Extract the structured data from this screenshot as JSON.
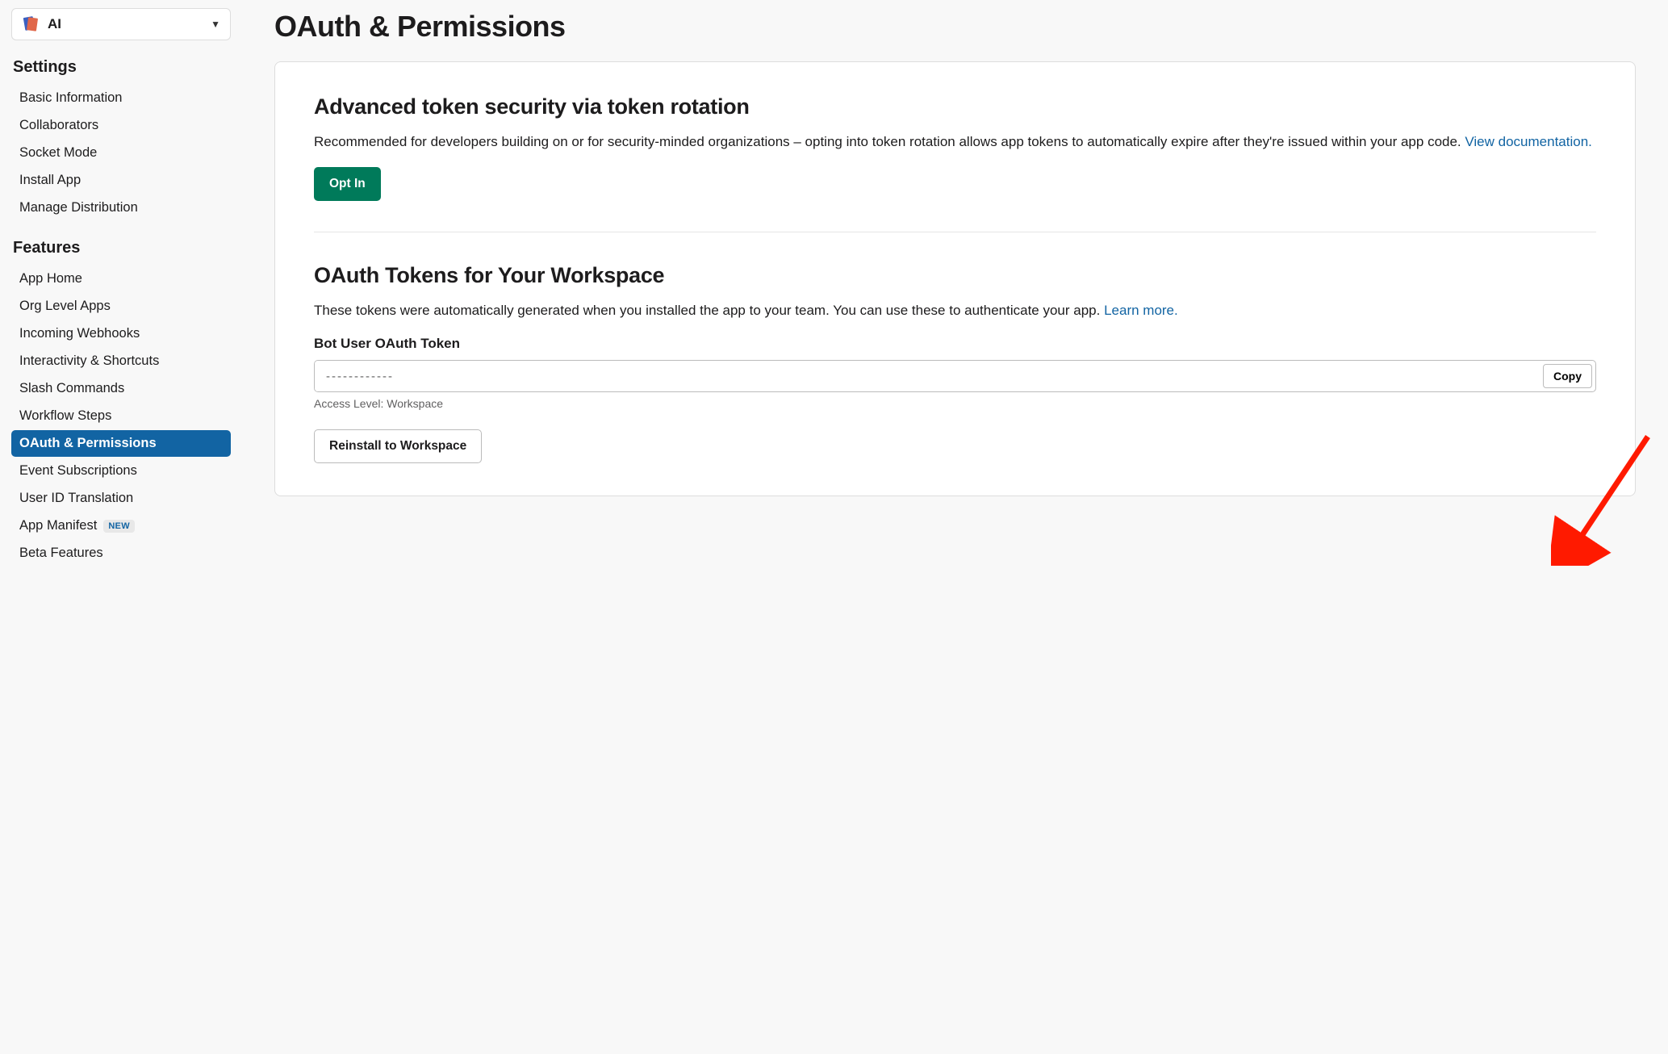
{
  "app_selector": {
    "name": "AI"
  },
  "sidebar": {
    "settings_heading": "Settings",
    "settings_items": [
      {
        "label": "Basic Information",
        "active": false
      },
      {
        "label": "Collaborators",
        "active": false
      },
      {
        "label": "Socket Mode",
        "active": false
      },
      {
        "label": "Install App",
        "active": false
      },
      {
        "label": "Manage Distribution",
        "active": false
      }
    ],
    "features_heading": "Features",
    "features_items": [
      {
        "label": "App Home",
        "active": false,
        "badge": null
      },
      {
        "label": "Org Level Apps",
        "active": false,
        "badge": null
      },
      {
        "label": "Incoming Webhooks",
        "active": false,
        "badge": null
      },
      {
        "label": "Interactivity & Shortcuts",
        "active": false,
        "badge": null
      },
      {
        "label": "Slash Commands",
        "active": false,
        "badge": null
      },
      {
        "label": "Workflow Steps",
        "active": false,
        "badge": null
      },
      {
        "label": "OAuth & Permissions",
        "active": true,
        "badge": null
      },
      {
        "label": "Event Subscriptions",
        "active": false,
        "badge": null
      },
      {
        "label": "User ID Translation",
        "active": false,
        "badge": null
      },
      {
        "label": "App Manifest",
        "active": false,
        "badge": "NEW"
      },
      {
        "label": "Beta Features",
        "active": false,
        "badge": null
      }
    ]
  },
  "page": {
    "title": "OAuth & Permissions"
  },
  "token_rotation": {
    "heading": "Advanced token security via token rotation",
    "description": "Recommended for developers building on or for security-minded organizations – opting into token rotation allows app tokens to automatically expire after they're issued within your app code. ",
    "doc_link_label": "View documentation.",
    "opt_in_label": "Opt In"
  },
  "oauth_tokens": {
    "heading": "OAuth Tokens for Your Workspace",
    "description": "These tokens were automatically generated when you installed the app to your team. You can use these to authenticate your app. ",
    "learn_more_label": "Learn more.",
    "bot_token_label": "Bot User OAuth Token",
    "bot_token_value": "------------",
    "copy_label": "Copy",
    "access_level": "Access Level: Workspace",
    "reinstall_label": "Reinstall to Workspace"
  }
}
